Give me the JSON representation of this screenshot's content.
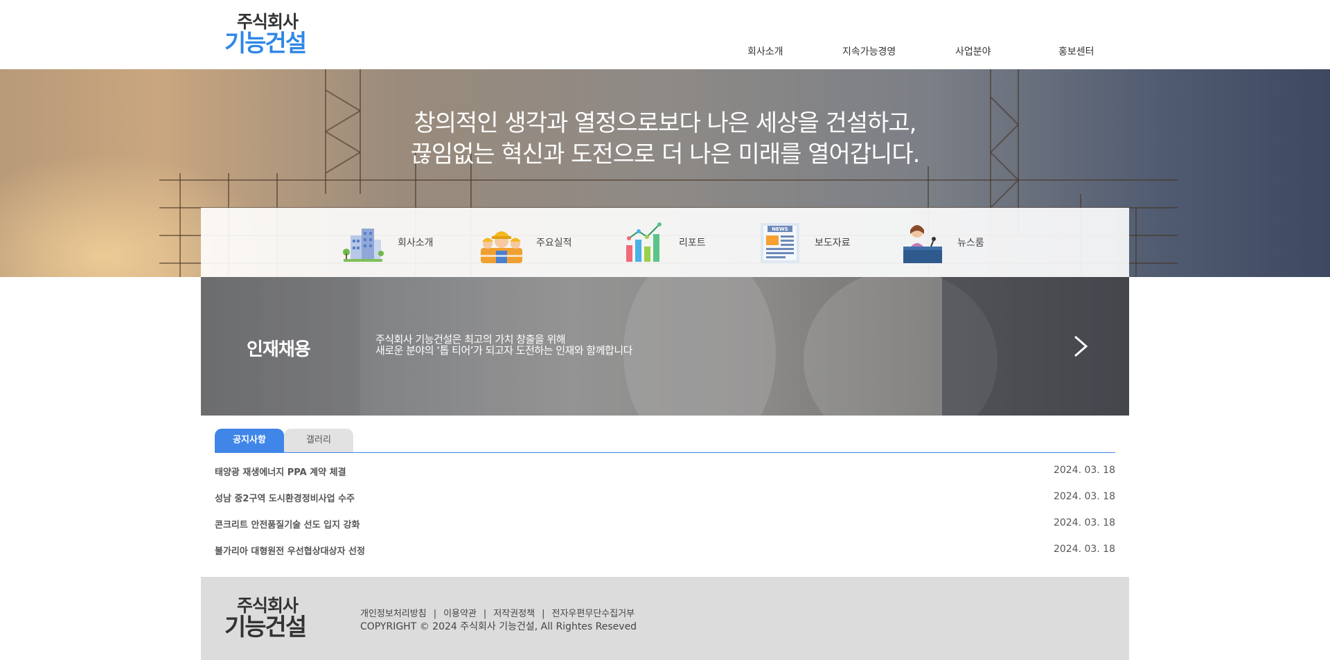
{
  "header": {
    "logo_line1": "주식회사",
    "logo_line2": "기능건설",
    "nav": [
      "회사소개",
      "지속가능경영",
      "사업분야",
      "홍보센터"
    ]
  },
  "hero": {
    "line1": "창의적인 생각과 열정으로보다 나은 세상을 건설하고,",
    "line2": "끊임없는 혁신과 도전으로 더 나은 미래를 열어갑니다."
  },
  "quick_menu": [
    {
      "label": "회사소개",
      "icon": "building-icon"
    },
    {
      "label": "주요실적",
      "icon": "construction-workers-icon"
    },
    {
      "label": "리포트",
      "icon": "bar-chart-icon"
    },
    {
      "label": "보도자료",
      "icon": "newspaper-icon"
    },
    {
      "label": "뉴스룸",
      "icon": "news-anchor-icon"
    }
  ],
  "recruit": {
    "title": "인재채용",
    "desc_line1": "주식회사 기능건설은 최고의 가치 창출을 위해",
    "desc_line2": "새로운 분야의 ‘톱 티어’가 되고자 도전하는 인재와 함께합니다",
    "arrow_icon": "chevron-right-icon"
  },
  "board": {
    "tabs": [
      "공지사항",
      "갤러리"
    ],
    "active_tab": "공지사항",
    "rows": [
      {
        "title": "태양광 재생에너지 PPA 계약 체결",
        "date": "2024. 03. 18"
      },
      {
        "title": "성남 중2구역 도시환경정비사업 수주",
        "date": "2024. 03. 18"
      },
      {
        "title": "콘크리트 안전품질기술 선도 입지 강화",
        "date": "2024. 03. 18"
      },
      {
        "title": "불가리아 대형원전 우선협상대상자 선정",
        "date": "2024. 03. 18"
      }
    ]
  },
  "footer": {
    "logo_line1": "주식회사",
    "logo_line2": "기능건설",
    "links": [
      "개인정보처리방침",
      "이용약관",
      "저작권정책",
      "전자우편무단수집거부"
    ],
    "separator": "|",
    "copyright": "COPYRIGHT © 2024 주식회사 기능건설, All Rightes Reseved"
  },
  "colors": {
    "accent": "#3f86e8",
    "logo_blue": "#2f87e8",
    "footer_bg": "#dcdcdc"
  }
}
